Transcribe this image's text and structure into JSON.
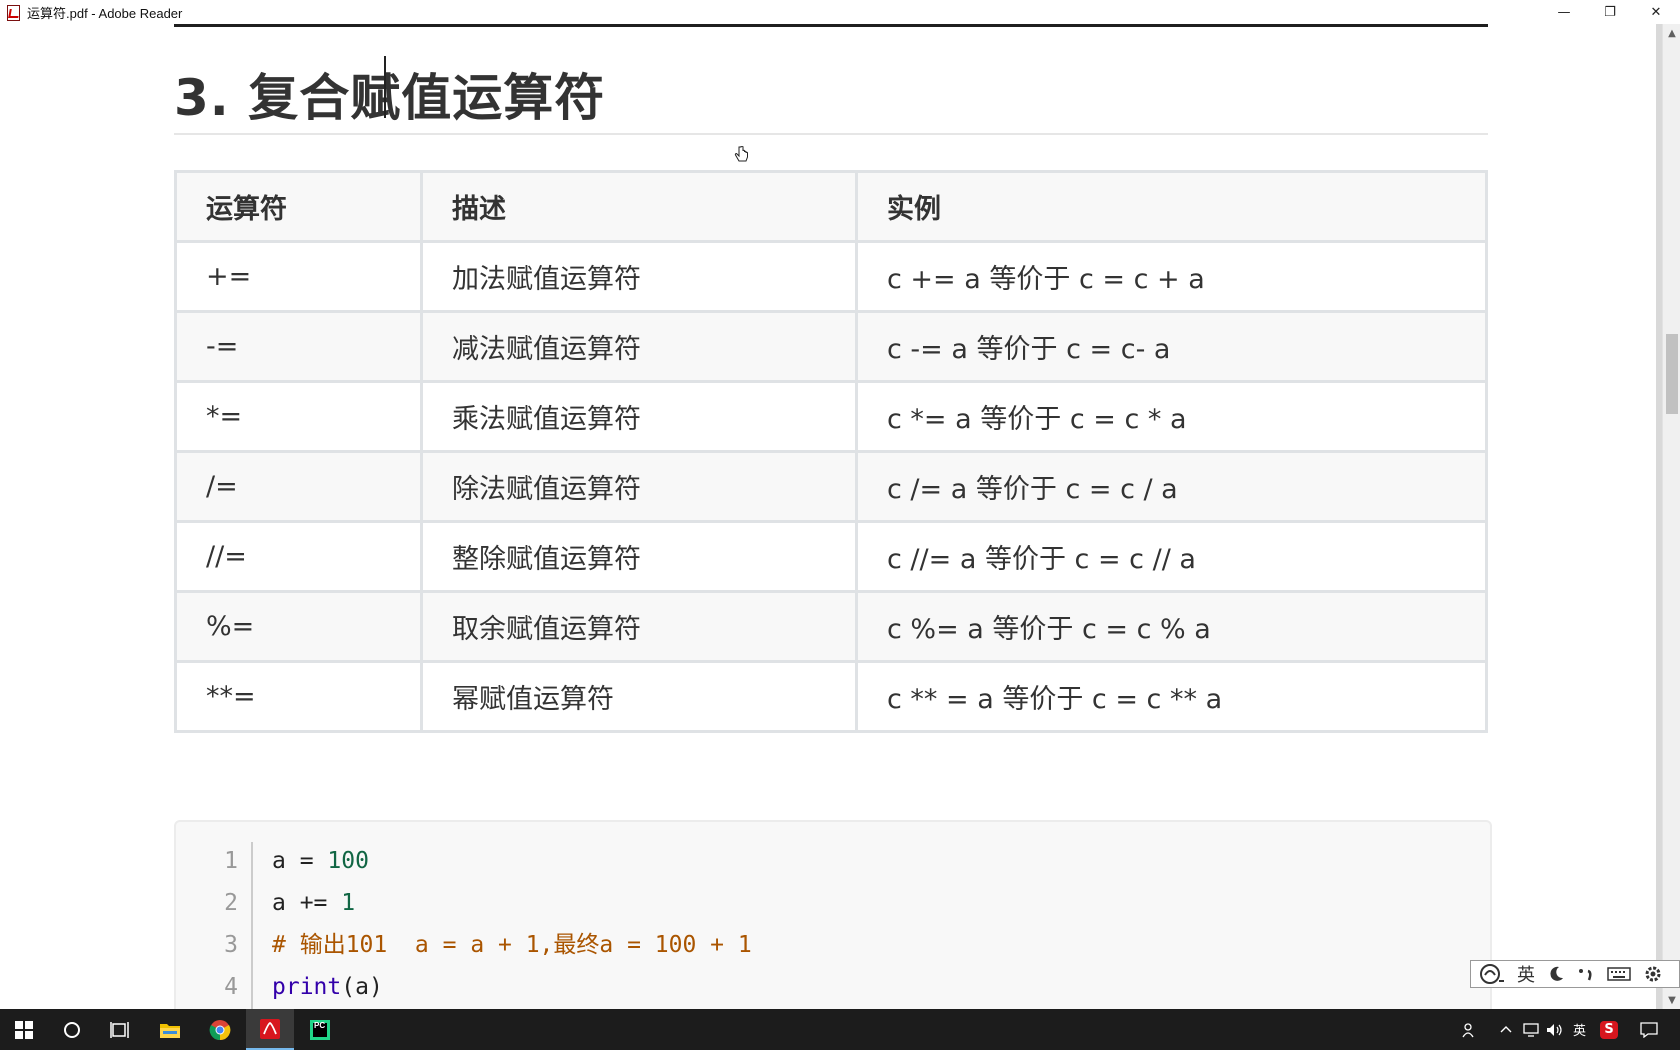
{
  "window": {
    "title": "运算符.pdf - Adobe Reader",
    "icon": "adobe-reader-icon",
    "minimize_glyph": "—",
    "maximize_glyph": "❐",
    "close_glyph": "✕"
  },
  "document": {
    "heading": "3. 复合赋值运算符",
    "table": {
      "headers": [
        "运算符",
        "描述",
        "实例"
      ],
      "rows": [
        {
          "op": "+=",
          "desc": "加法赋值运算符",
          "example": "c += a 等价于 c = c + a"
        },
        {
          "op": "-=",
          "desc": "减法赋值运算符",
          "example": "c -= a 等价于 c = c- a"
        },
        {
          "op": "*=",
          "desc": "乘法赋值运算符",
          "example": "c *= a 等价于 c = c * a"
        },
        {
          "op": "/=",
          "desc": "除法赋值运算符",
          "example": "c /= a 等价于 c = c / a"
        },
        {
          "op": "//=",
          "desc": "整除赋值运算符",
          "example": "c //= a 等价于 c = c // a"
        },
        {
          "op": "%=",
          "desc": "取余赋值运算符",
          "example": "c %= a 等价于 c = c % a"
        },
        {
          "op": "**=",
          "desc": "幂赋值运算符",
          "example": "c ** = a 等价于 c = c ** a"
        }
      ]
    },
    "code": {
      "line_numbers": [
        "1",
        "2",
        "3",
        "4"
      ],
      "line1": {
        "var": "a",
        "op": " = ",
        "num": "100"
      },
      "line2": {
        "var": "a",
        "op": " += ",
        "num": "1"
      },
      "line3": {
        "comment": "# 输出101  a = a + 1,最终a = 100 + 1"
      },
      "line4": {
        "fn": "print",
        "args": "(a)"
      }
    }
  },
  "ime_toolbar": {
    "lang_label": "英",
    "icons": [
      "ime-logo-icon",
      "moon-icon",
      "punctuation-icon",
      "keyboard-icon",
      "settings-icon"
    ]
  },
  "taskbar": {
    "apps": [
      "windows-start-icon",
      "cortana-search-icon",
      "task-view-icon",
      "file-explorer-icon",
      "chrome-icon",
      "adobe-reader-icon",
      "pycharm-icon"
    ],
    "pycharm_label": "PC",
    "tray_lang": "英",
    "tray_ime": "S",
    "colors": {
      "taskbar_bg": "#1c1c1c",
      "active_underline": "#76b9ed",
      "adobe_red": "#d7161e",
      "explorer_yellow": "#f0c000"
    }
  }
}
